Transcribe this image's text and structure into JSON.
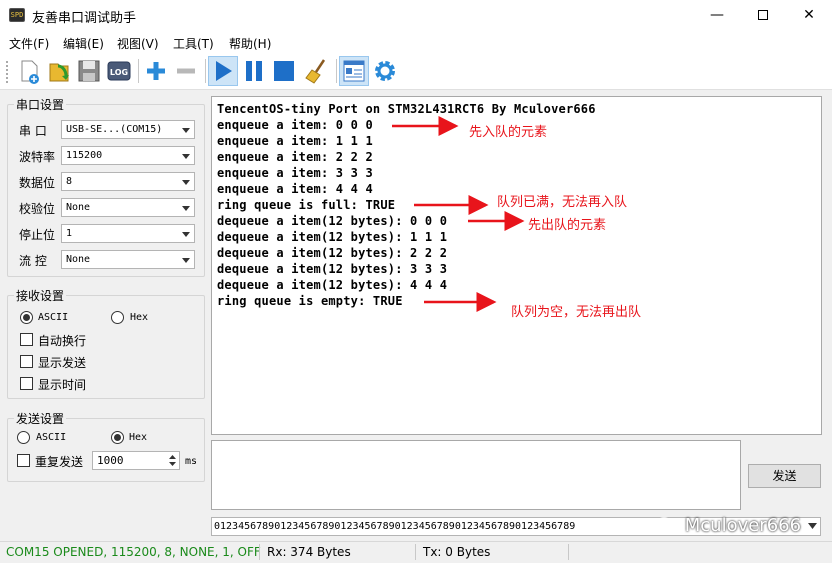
{
  "window": {
    "title": "友善串口调试助手",
    "icon_name": "app-icon",
    "icon_text": "SPD",
    "minimize": "—",
    "close": "✕"
  },
  "menu": [
    "文件(F)",
    "编辑(E)",
    "视图(V)",
    "工具(T)",
    "帮助(H)"
  ],
  "toolbar": {
    "buttons": [
      "new-file-icon",
      "open-folder-icon",
      "save-icon",
      "log-icon",
      "add-icon",
      "remove-icon",
      "play-icon",
      "pause-icon",
      "stop-icon",
      "clear-broom-icon",
      "window-layout-icon",
      "settings-gear-icon"
    ],
    "log_label": "LOG",
    "active_button": "play-icon"
  },
  "serial_settings": {
    "title": "串口设置",
    "port_label": "串  口",
    "port_value": "USB-SE...(COM15)",
    "baud_label": "波特率",
    "baud_value": "115200",
    "databits_label": "数据位",
    "databits_value": "8",
    "parity_label": "校验位",
    "parity_value": "None",
    "stopbits_label": "停止位",
    "stopbits_value": "1",
    "flow_label": "流  控",
    "flow_value": "None"
  },
  "receive_settings": {
    "title": "接收设置",
    "ascii_label": "ASCII",
    "hex_label": "Hex",
    "selected": "ASCII",
    "auto_newline_label": "自动换行",
    "show_send_label": "显示发送",
    "show_time_label": "显示时间",
    "auto_newline": false,
    "show_send": false,
    "show_time": false
  },
  "send_settings": {
    "title": "发送设置",
    "ascii_label": "ASCII",
    "hex_label": "Hex",
    "selected": "Hex",
    "repeat_label": "重复发送",
    "repeat": false,
    "interval_value": "1000",
    "interval_unit": "ms"
  },
  "receive_log": [
    "TencentOS-tiny Port on STM32L431RCT6 By Mculover666",
    "enqueue a item: 0 0 0",
    "enqueue a item: 1 1 1",
    "enqueue a item: 2 2 2",
    "enqueue a item: 3 3 3",
    "enqueue a item: 4 4 4",
    "ring queue is full: TRUE",
    "dequeue a item(12 bytes): 0 0 0",
    "dequeue a item(12 bytes): 1 1 1",
    "dequeue a item(12 bytes): 2 2 2",
    "dequeue a item(12 bytes): 3 3 3",
    "dequeue a item(12 bytes): 4 4 4",
    "ring queue is empty: TRUE"
  ],
  "annotations": {
    "color": "#e8141b",
    "items": [
      "先入队的元素",
      "队列已满，无法再入队",
      "先出队的元素",
      "队列为空，无法再出队"
    ]
  },
  "send": {
    "input_value": "",
    "button_label": "发送",
    "history_value": "012345678901234567890123456789012345678901234567890123456789"
  },
  "watermark": "Mculover666",
  "status": {
    "port_status": "COM15 OPENED, 115200, 8, NONE, 1, OFF",
    "port_status_color": "#1a8a1a",
    "rx": "Rx: 374 Bytes",
    "tx": "Tx: 0 Bytes"
  }
}
